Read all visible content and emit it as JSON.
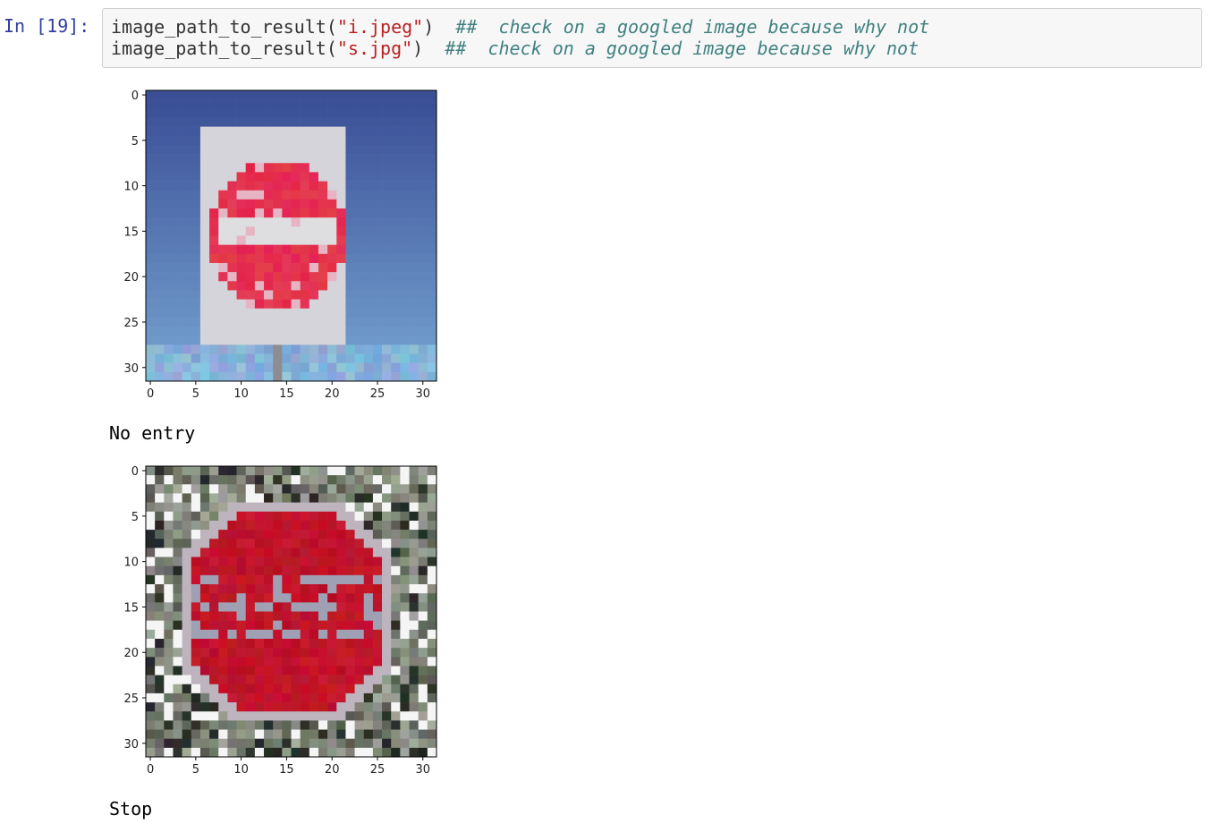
{
  "cell": {
    "prompt": "In [19]:",
    "lines": [
      {
        "func": "image_path_to_result(",
        "arg": "\"i.jpeg\"",
        "close": ")",
        "comment": "##  check on a googled image because why not"
      },
      {
        "func": "image_path_to_result(",
        "arg": "\"s.jpg\"",
        "close": ")",
        "comment": "##  check on a googled image because why not"
      }
    ]
  },
  "outputs": [
    {
      "result": "No entry",
      "chart_data": {
        "type": "heatmap",
        "xticks": [
          0,
          5,
          10,
          15,
          20,
          25,
          30
        ],
        "yticks": [
          0,
          5,
          10,
          15,
          20,
          25,
          30
        ],
        "xlim": [
          -0.5,
          31.5
        ],
        "ylim": [
          31.5,
          -0.5
        ]
      }
    },
    {
      "result": "Stop",
      "chart_data": {
        "type": "heatmap",
        "xticks": [
          0,
          5,
          10,
          15,
          20,
          25,
          30
        ],
        "yticks": [
          0,
          5,
          10,
          15,
          20,
          25,
          30
        ],
        "xlim": [
          -0.5,
          31.5
        ],
        "ylim": [
          31.5,
          -0.5
        ]
      }
    }
  ],
  "colors": {
    "prompt": "#303f9f",
    "string": "#ba2121",
    "comment": "#408080"
  }
}
